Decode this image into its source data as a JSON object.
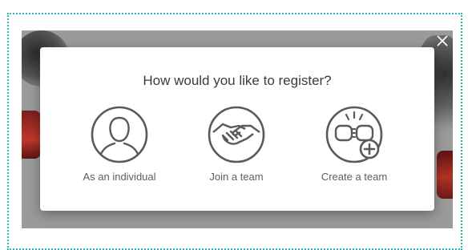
{
  "modal": {
    "title": "How would you like to register?",
    "options": [
      {
        "label": "As an individual",
        "icon": "person-icon"
      },
      {
        "label": "Join a team",
        "icon": "handshake-icon"
      },
      {
        "label": "Create a team",
        "icon": "fist-bump-plus-icon"
      }
    ]
  },
  "icons": {
    "close": "close-icon"
  },
  "colors": {
    "frame_border": "#2fb3b8",
    "overlay_bg": "#9a9a9a",
    "icon_stroke": "#5a5a5a",
    "title_text": "#3b3b3b",
    "label_text": "#5f5f5f"
  }
}
